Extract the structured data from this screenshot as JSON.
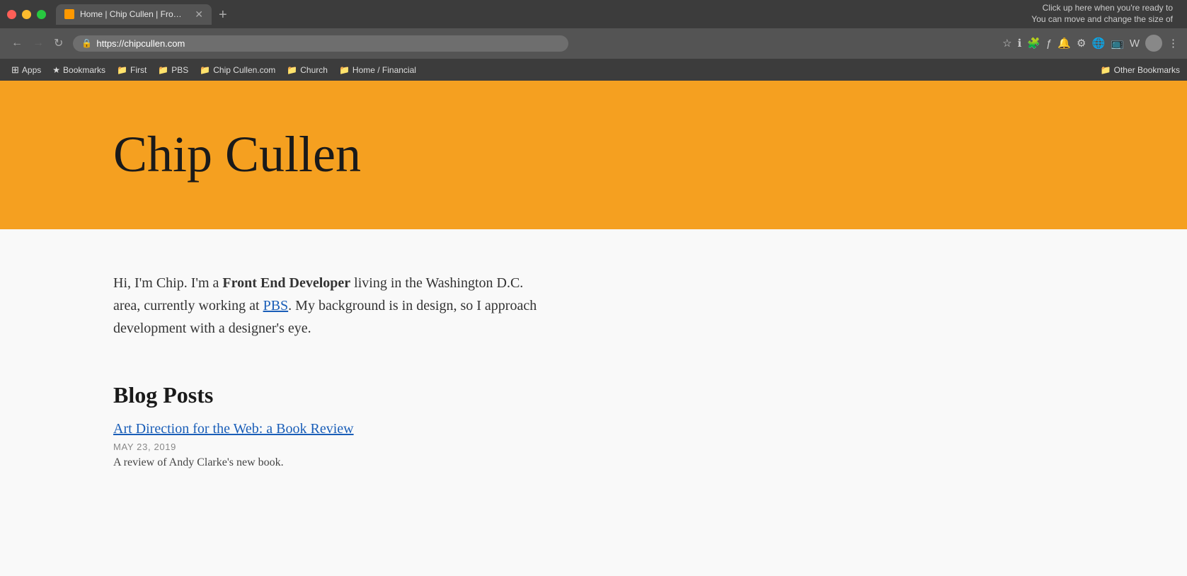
{
  "browser": {
    "tab": {
      "favicon_color": "#f5a020",
      "title": "Home | Chip Cullen | Front End…",
      "close_icon": "✕",
      "new_tab_icon": "+"
    },
    "top_right_hint": {
      "line1": "Click up here when you're ready to",
      "line2": "You can move and change the size of"
    },
    "address": {
      "url": "https://chipcullen.com",
      "lock_icon": "🔒",
      "back_icon": "←",
      "forward_icon": "→",
      "reload_icon": "↻"
    },
    "bookmarks": [
      {
        "icon": "⊞",
        "label": "Apps",
        "is_apps": true
      },
      {
        "icon": "★",
        "label": "Bookmarks"
      },
      {
        "icon": "📁",
        "label": "First"
      },
      {
        "icon": "📁",
        "label": "PBS"
      },
      {
        "icon": "📁",
        "label": "Chip Cullen.com"
      },
      {
        "icon": "📁",
        "label": "Church"
      },
      {
        "icon": "📁",
        "label": "Home / Financial"
      }
    ],
    "bookmarks_right": "Other Bookmarks"
  },
  "site": {
    "header": {
      "title": "Chip Cullen",
      "bg_color": "#f5a020"
    },
    "intro": {
      "text_before_bold": "Hi, I'm Chip. I'm a ",
      "bold_text": "Front End Developer",
      "text_after_bold": " living in the Washington D.C. area, currently working at ",
      "pbs_link": "PBS",
      "text_after_link": ". My background is in design, so I approach development with a designer's eye."
    },
    "blog": {
      "section_title": "Blog Posts",
      "posts": [
        {
          "title": "Art Direction for the Web: a Book Review",
          "date": "MAY 23, 2019",
          "excerpt": "A review of Andy Clarke's new book."
        }
      ]
    }
  }
}
